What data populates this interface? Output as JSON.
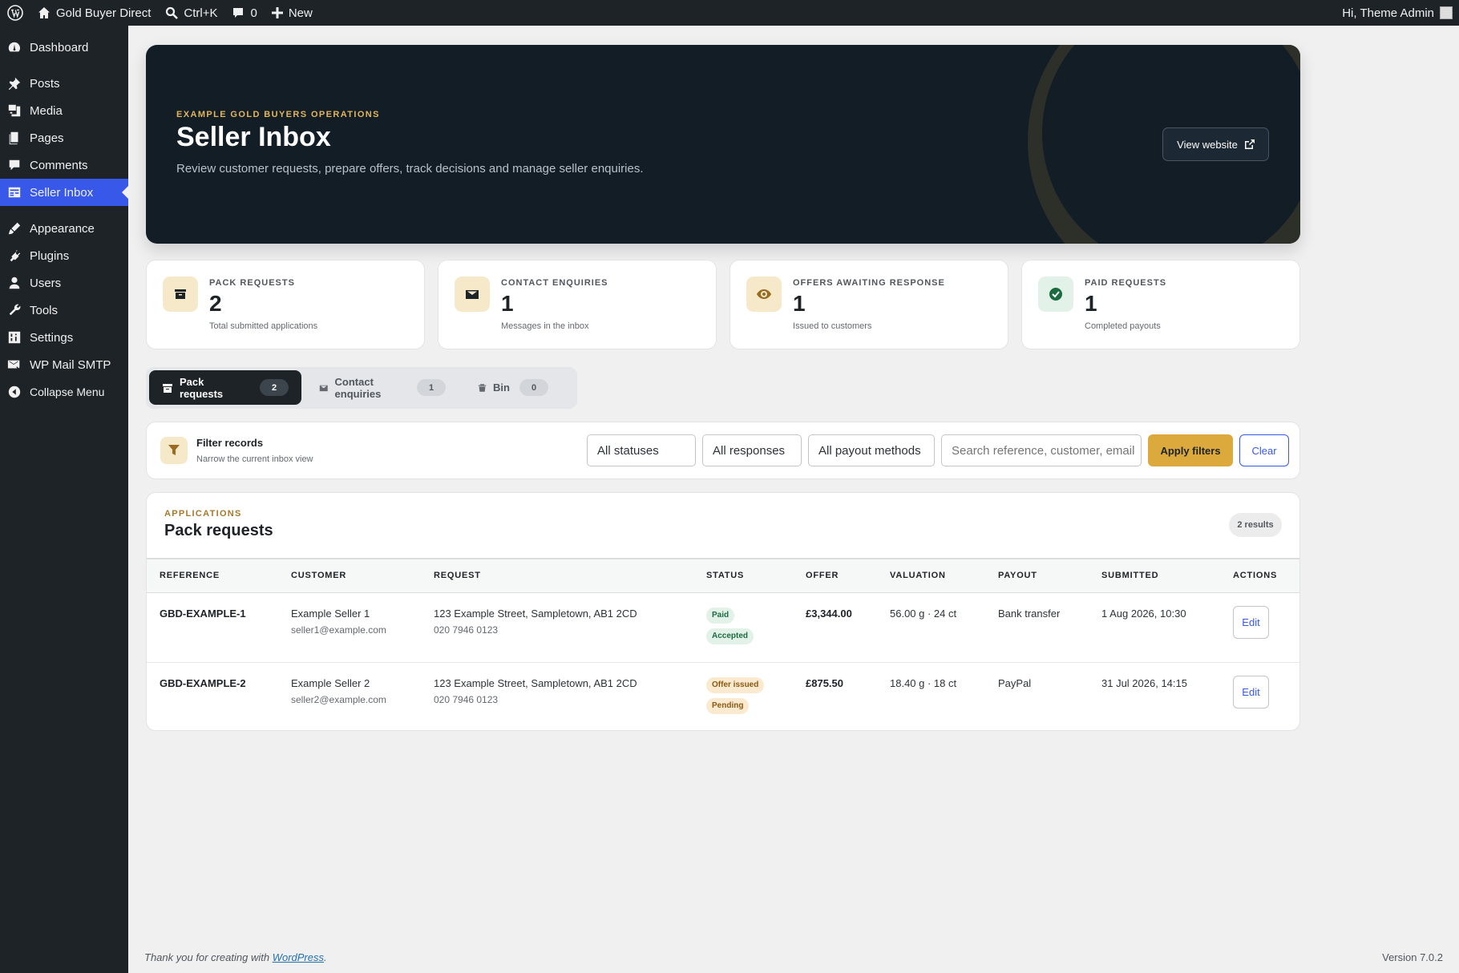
{
  "adminbar": {
    "site_name": "Gold Buyer Direct",
    "search_shortcut": "Ctrl+K",
    "comments_count": "0",
    "new_label": "New",
    "greeting": "Hi, Theme Admin"
  },
  "sidebar": {
    "items": [
      {
        "label": "Dashboard",
        "icon": "dashboard-icon"
      },
      {
        "label": "Posts",
        "icon": "pin-icon"
      },
      {
        "label": "Media",
        "icon": "media-icon"
      },
      {
        "label": "Pages",
        "icon": "pages-icon"
      },
      {
        "label": "Comments",
        "icon": "comment-icon"
      },
      {
        "label": "Seller Inbox",
        "icon": "inbox-icon",
        "active": true
      },
      {
        "label": "Appearance",
        "icon": "brush-icon"
      },
      {
        "label": "Plugins",
        "icon": "plug-icon"
      },
      {
        "label": "Users",
        "icon": "user-icon"
      },
      {
        "label": "Tools",
        "icon": "wrench-icon"
      },
      {
        "label": "Settings",
        "icon": "settings-icon"
      },
      {
        "label": "WP Mail SMTP",
        "icon": "mail-icon"
      },
      {
        "label": "Collapse Menu",
        "icon": "collapse-icon"
      }
    ]
  },
  "hero": {
    "eyebrow": "EXAMPLE GOLD BUYERS OPERATIONS",
    "title": "Seller Inbox",
    "subtitle": "Review customer requests, prepare offers, track decisions and manage seller enquiries.",
    "view_button": "View website"
  },
  "stats": [
    {
      "label": "PACK REQUESTS",
      "value": "2",
      "note": "Total submitted applications",
      "icon": "archive-icon"
    },
    {
      "label": "CONTACT ENQUIRIES",
      "value": "1",
      "note": "Messages in the inbox",
      "icon": "envelope-icon"
    },
    {
      "label": "OFFERS AWAITING RESPONSE",
      "value": "1",
      "note": "Issued to customers",
      "icon": "eye-icon"
    },
    {
      "label": "PAID REQUESTS",
      "value": "1",
      "note": "Completed payouts",
      "icon": "check-circle-icon"
    }
  ],
  "tabs": [
    {
      "label": "Pack requests",
      "count": "2"
    },
    {
      "label": "Contact enquiries",
      "count": "1"
    },
    {
      "label": "Bin",
      "count": "0"
    }
  ],
  "filter": {
    "title": "Filter records",
    "subtitle": "Narrow the current inbox view",
    "status_select": "All statuses",
    "response_select": "All responses",
    "payout_select": "All payout methods",
    "search_placeholder": "Search reference, customer, email",
    "apply_label": "Apply filters",
    "clear_label": "Clear"
  },
  "table": {
    "eyebrow": "APPLICATIONS",
    "title": "Pack requests",
    "results": "2 results",
    "columns": [
      "REFERENCE",
      "CUSTOMER",
      "REQUEST",
      "STATUS",
      "OFFER",
      "VALUATION",
      "PAYOUT",
      "SUBMITTED",
      "ACTIONS"
    ],
    "rows": [
      {
        "reference": "GBD-EXAMPLE-1",
        "customer": "Example Seller 1",
        "email": "seller1@example.com",
        "address": "123 Example Street, Sampletown, AB1 2CD",
        "phone": "020 7946 0123",
        "status": "Paid",
        "response": "Accepted",
        "offer": "£3,344.00",
        "valuation": "56.00 g · 24 ct",
        "payout": "Bank transfer",
        "submitted": "1 Aug 2026, 10:30",
        "action": "Edit"
      },
      {
        "reference": "GBD-EXAMPLE-2",
        "customer": "Example Seller 2",
        "email": "seller2@example.com",
        "address": "123 Example Street, Sampletown, AB1 2CD",
        "phone": "020 7946 0123",
        "status": "Offer issued",
        "response": "Pending",
        "offer": "£875.50",
        "valuation": "18.40 g · 18 ct",
        "payout": "PayPal",
        "submitted": "31 Jul 2026, 14:15",
        "action": "Edit"
      }
    ]
  },
  "footer": {
    "thanks_prefix": "Thank you for creating with ",
    "thanks_link": "WordPress",
    "thanks_suffix": ".",
    "version": "Version 7.0.2"
  },
  "colors": {
    "accent": "#3858e9",
    "gold": "#dba93c",
    "hero_bg": "#121d26",
    "sidebar_bg": "#1d2327"
  }
}
